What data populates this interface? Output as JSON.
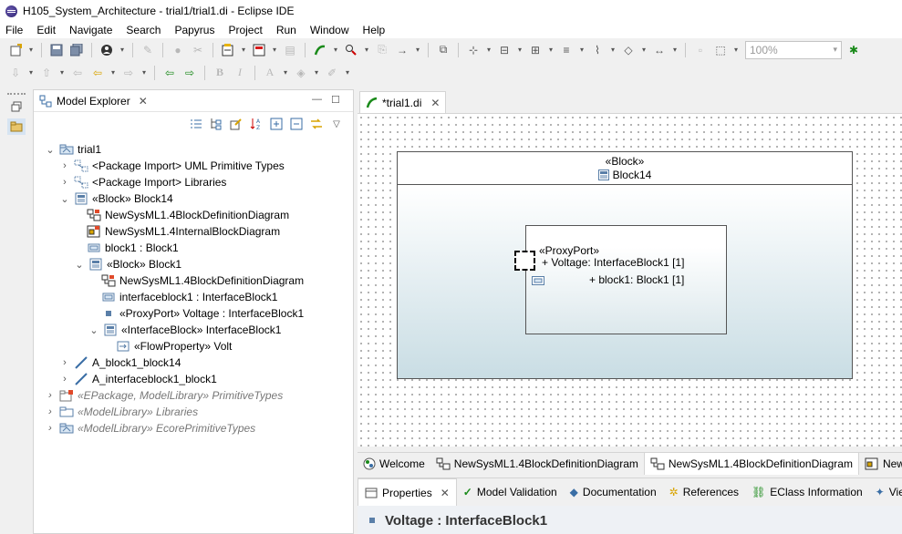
{
  "window": {
    "title": "H105_System_Architecture - trial1/trial1.di - Eclipse IDE"
  },
  "menu": [
    "File",
    "Edit",
    "Navigate",
    "Search",
    "Papyrus",
    "Project",
    "Run",
    "Window",
    "Help"
  ],
  "toolbar": {
    "zoom": "100%"
  },
  "explorer": {
    "title": "Model Explorer",
    "tree": [
      {
        "label": "trial1"
      },
      {
        "label": "<Package Import> UML Primitive Types"
      },
      {
        "label": "<Package Import> Libraries"
      },
      {
        "label": "«Block» Block14"
      },
      {
        "label": "NewSysML1.4BlockDefinitionDiagram"
      },
      {
        "label": "NewSysML1.4InternalBlockDiagram"
      },
      {
        "label": "block1 : Block1"
      },
      {
        "label": "«Block» Block1"
      },
      {
        "label": "NewSysML1.4BlockDefinitionDiagram"
      },
      {
        "label": "interfaceblock1 : InterfaceBlock1"
      },
      {
        "label": "«ProxyPort» Voltage : InterfaceBlock1"
      },
      {
        "label": "«InterfaceBlock» InterfaceBlock1"
      },
      {
        "label": "«FlowProperty» Volt"
      },
      {
        "label": "A_block1_block14"
      },
      {
        "label": "A_interfaceblock1_block1"
      },
      {
        "label": "«EPackage, ModelLibrary» PrimitiveTypes"
      },
      {
        "label": "«ModelLibrary» Libraries"
      },
      {
        "label": "«ModelLibrary» EcorePrimitiveTypes"
      }
    ]
  },
  "editor": {
    "tab": "*trial1.di",
    "diagram": {
      "block_stereotype": "«Block»",
      "block_name": "Block14",
      "port_stereotype": "«ProxyPort»",
      "port_label": "+ Voltage: InterfaceBlock1 [1]",
      "part_label": "+ block1: Block1 [1]"
    }
  },
  "bottom_tabs": [
    "Welcome",
    "NewSysML1.4BlockDefinitionDiagram",
    "NewSysML1.4BlockDefinitionDiagram",
    "NewSys"
  ],
  "properties": {
    "tabs": [
      "Properties",
      "Model Validation",
      "Documentation",
      "References",
      "EClass Information",
      "View"
    ],
    "title": "Voltage : InterfaceBlock1"
  }
}
